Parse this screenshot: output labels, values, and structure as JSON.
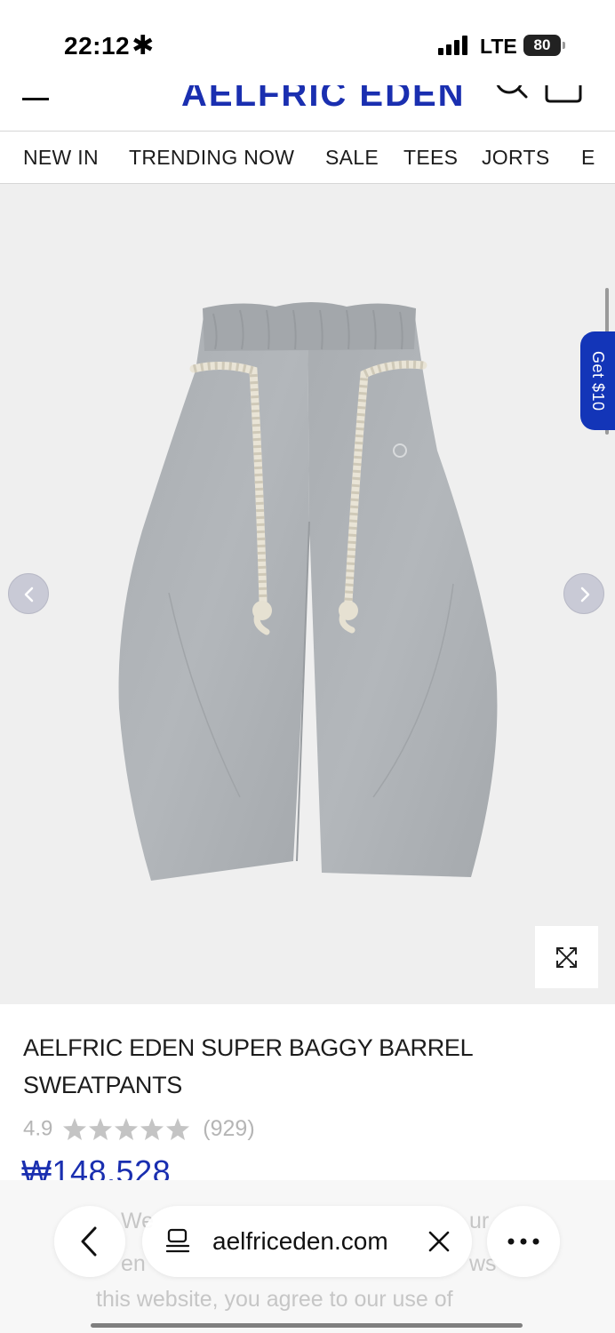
{
  "status_bar": {
    "time": "22:12",
    "time_symbol": "✱",
    "network": "LTE",
    "battery": "80"
  },
  "header": {
    "logo": "AELFRIC EDEN",
    "brand_color": "#1a2fb0"
  },
  "nav": {
    "items": [
      "NEW IN",
      "TRENDING NOW",
      "SALE",
      "TEES",
      "JORTS",
      "E"
    ]
  },
  "gallery": {
    "promo_tab": "Get $10",
    "promo_color": "#1335b8",
    "icons": [
      "chevron-left-icon",
      "chevron-right-icon",
      "expand-icon"
    ]
  },
  "product": {
    "title": "AELFRIC EDEN SUPER BAGGY BARREL SWEATPANTS",
    "rating": "4.9",
    "stars": 5,
    "review_count": "(929)",
    "price": "₩148,528"
  },
  "cookie_notice": {
    "fragment_1": "We",
    "fragment_2": "ur",
    "fragment_3": "en",
    "fragment_4": "ws",
    "line_3": "this website, you agree to our use of"
  },
  "browser": {
    "url": "aelfriceden.com",
    "icons": [
      "back-icon",
      "tabs-icon",
      "close-icon",
      "more-icon"
    ]
  }
}
